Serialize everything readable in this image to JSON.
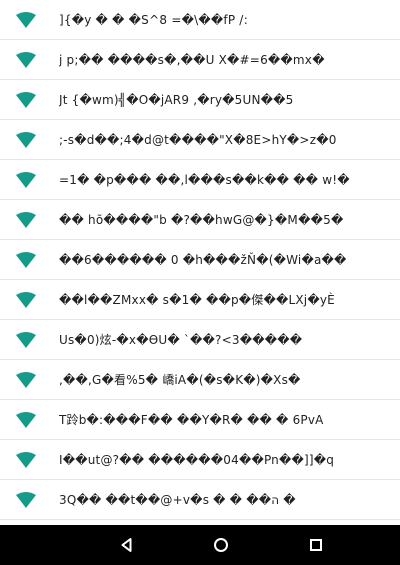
{
  "theme": {
    "wifi_icon_color": "#169b8b",
    "divider_color": "#e6e6e6",
    "navbar_color": "#000000",
    "nav_icon_color": "#ffffff"
  },
  "network_list": {
    "items": [
      {
        "ssid": "]{�y �  � �S\u0014^8 \u0014=�\\��fP /\u0014:"
      },
      {
        "ssid": "j p;��  ����s�,��U X�#=6��mx\u0014�"
      },
      {
        "ssid": "  Jt  {�wm)╣�O�jAR9 ,�ry�5UN��5"
      },
      {
        "ssid": ";-s�d��;4�d@t����\"X�8E>hY�>z�0"
      },
      {
        "ssid": "=1�  �p���  ��,l���s��k��   �� w!�"
      },
      {
        "ssid": "�� hõ����\"b   �?��hwG@�}�M\u0014��5�"
      },
      {
        "ssid": "��6������  0  �h���žŇ�(�Wi�a��"
      },
      {
        "ssid": "��l��ZMxx�  s�1�  ��p�傑��LXj�yÈ"
      },
      {
        "ssid": "  Us�0)炫-�x�ӨU�   `��?<3�����"
      },
      {
        "ssid": ",��,G�看%5�  嶠iA�(�s�K�)�Xs�"
      },
      {
        "ssid": "T跉b�:���F��  ��Y�R�  ��  �  6PvA"
      },
      {
        "ssid": "I��ut@?��    ������04��Pn��]]�q"
      },
      {
        "ssid": "3Q��  ��t��@+v�s  �  �  ��ה  �"
      }
    ]
  },
  "navbar": {
    "back_icon": "back-triangle-icon",
    "home_icon": "home-circle-icon",
    "recents_icon": "recents-square-icon"
  }
}
